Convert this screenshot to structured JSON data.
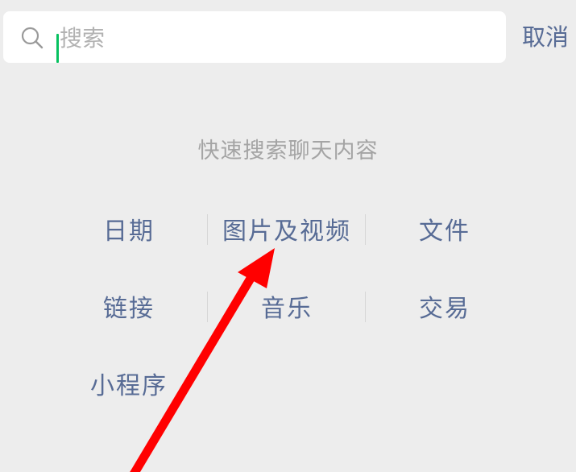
{
  "search": {
    "placeholder": "搜索",
    "value": "",
    "cancel_label": "取消"
  },
  "hint": "快速搜索聊天内容",
  "categories": [
    {
      "label": "日期"
    },
    {
      "label": "图片及视频"
    },
    {
      "label": "文件"
    },
    {
      "label": "链接"
    },
    {
      "label": "音乐"
    },
    {
      "label": "交易"
    },
    {
      "label": "小程序"
    }
  ],
  "annotation": {
    "arrow_color": "#ff0000",
    "points_to": "图片及视频"
  },
  "colors": {
    "background": "#ededed",
    "link": "#576b95",
    "cursor": "#07c160",
    "hint": "#a4a4a4"
  }
}
